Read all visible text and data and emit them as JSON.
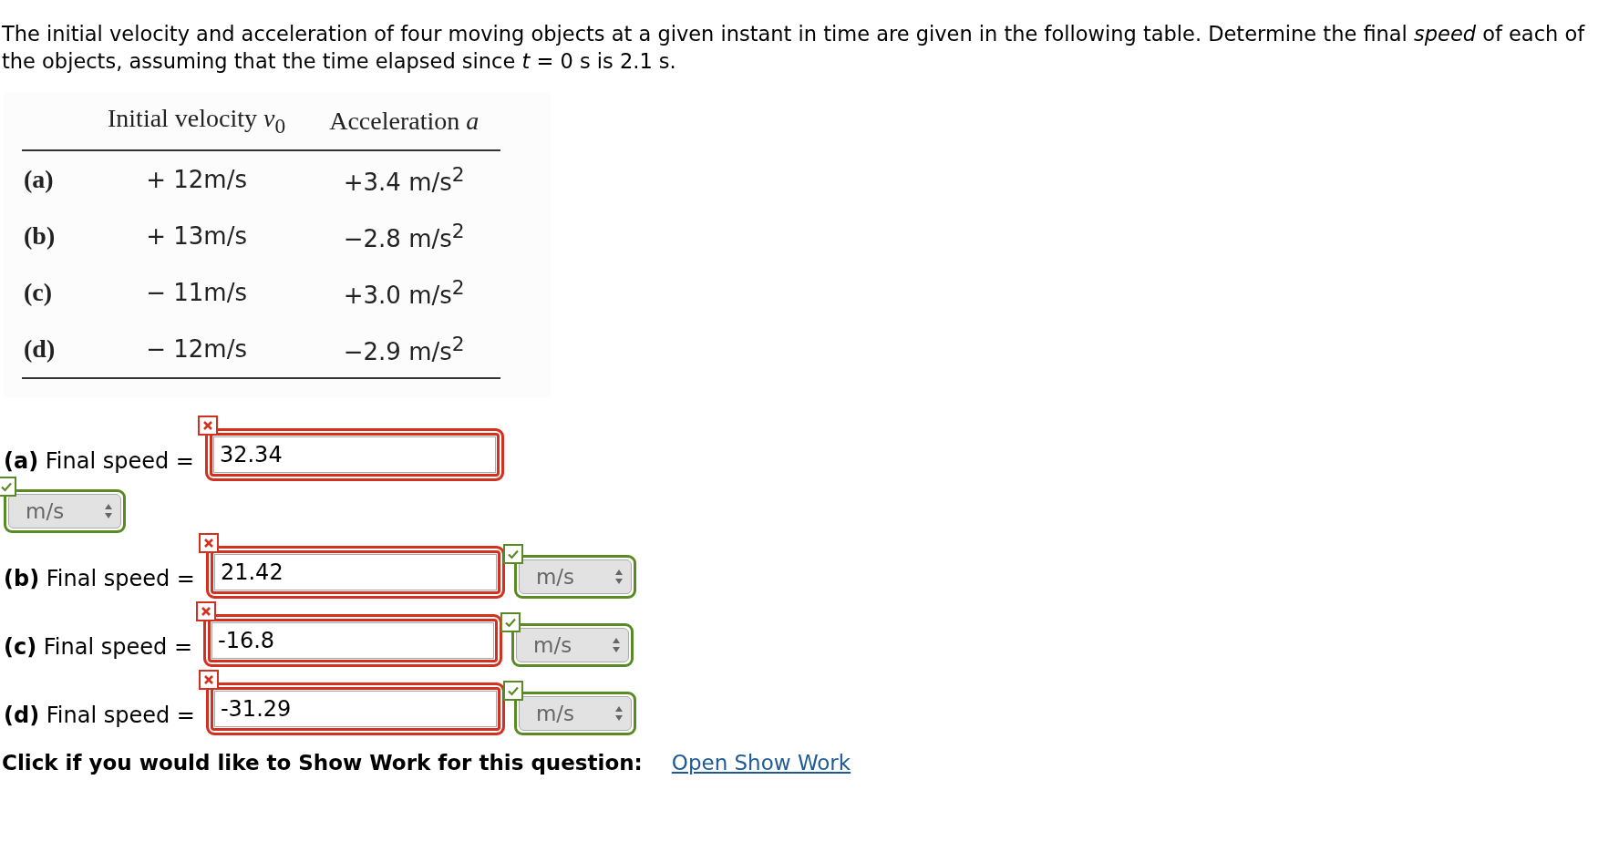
{
  "intro": "The initial velocity and acceleration of four moving objects at a given instant in time are given in the following table. Determine the final *speed* of each of the objects, assuming that the time elapsed since *t* = 0 s is 2.1 s.",
  "table": {
    "columns": [
      "Initial velocity *v*$_{0}$",
      "Acceleration *a*"
    ],
    "rows": [
      {
        "label": "(a)",
        "velocity": "+ 12m/s",
        "acceleration": "+3.4 m/s$^{2}$"
      },
      {
        "label": "(b)",
        "velocity": "+ 13m/s",
        "acceleration": "−2.8 m/s$^{2}$"
      },
      {
        "label": "(c)",
        "velocity": "− 11m/s",
        "acceleration": "+3.0 m/s$^{2}$"
      },
      {
        "label": "(d)",
        "velocity": "− 12m/s",
        "acceleration": "−2.9 m/s$^{2}$"
      }
    ]
  },
  "answers": [
    {
      "label": "(a)",
      "text": "Final speed =",
      "value": "32.34",
      "value_correct": false,
      "unit": "m/s",
      "unit_correct": true
    },
    {
      "label": "(b)",
      "text": "Final speed =",
      "value": "21.42",
      "value_correct": false,
      "unit": "m/s",
      "unit_correct": true
    },
    {
      "label": "(c)",
      "text": "Final speed =",
      "value": "-16.8",
      "value_correct": false,
      "unit": "m/s",
      "unit_correct": true
    },
    {
      "label": "(d)",
      "text": "Final speed =",
      "value": "-31.29",
      "value_correct": false,
      "unit": "m/s",
      "unit_correct": true
    }
  ],
  "show_work": {
    "prompt": "Click if you would like to Show Work for this question:",
    "link": "Open Show Work"
  }
}
